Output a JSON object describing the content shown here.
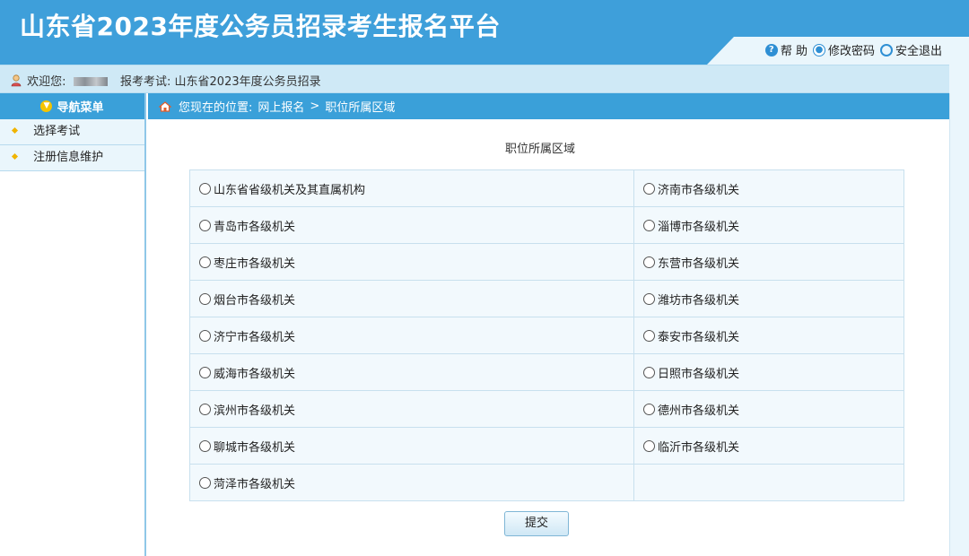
{
  "header": {
    "title": "山东省2023年度公务员招录考生报名平台",
    "links": {
      "help": "帮 助",
      "change_password": "修改密码",
      "logout": "安全退出"
    }
  },
  "infobar": {
    "welcome_label": "欢迎您:",
    "exam_label": "报考考试:",
    "exam_name": "山东省2023年度公务员招录"
  },
  "sidebar": {
    "title": "导航菜单",
    "items": [
      {
        "label": "选择考试"
      },
      {
        "label": "注册信息维护"
      }
    ]
  },
  "breadcrumb": {
    "prefix": "您现在的位置:",
    "level1": "网上报名",
    "sep": ">",
    "level2": "职位所属区域"
  },
  "page": {
    "title": "职位所属区域",
    "submit_label": "提交"
  },
  "options": [
    {
      "label": "山东省省级机关及其直属机构"
    },
    {
      "label": "济南市各级机关"
    },
    {
      "label": "青岛市各级机关"
    },
    {
      "label": "淄博市各级机关"
    },
    {
      "label": "枣庄市各级机关"
    },
    {
      "label": "东营市各级机关"
    },
    {
      "label": "烟台市各级机关"
    },
    {
      "label": "潍坊市各级机关"
    },
    {
      "label": "济宁市各级机关"
    },
    {
      "label": "泰安市各级机关"
    },
    {
      "label": "威海市各级机关"
    },
    {
      "label": "日照市各级机关"
    },
    {
      "label": "滨州市各级机关"
    },
    {
      "label": "德州市各级机关"
    },
    {
      "label": "聊城市各级机关"
    },
    {
      "label": "临沂市各级机关"
    },
    {
      "label": "菏泽市各级机关"
    }
  ],
  "colors": {
    "header_blue": "#3e9fda",
    "bar_blue": "#3aa0d9",
    "light_blue": "#eaf6fc",
    "accent_yellow": "#f0b400"
  },
  "icons": [
    "help-icon",
    "lock-icon",
    "power-icon",
    "user-icon",
    "arrow-down-icon",
    "home-icon",
    "diamond-bullet-icon"
  ]
}
